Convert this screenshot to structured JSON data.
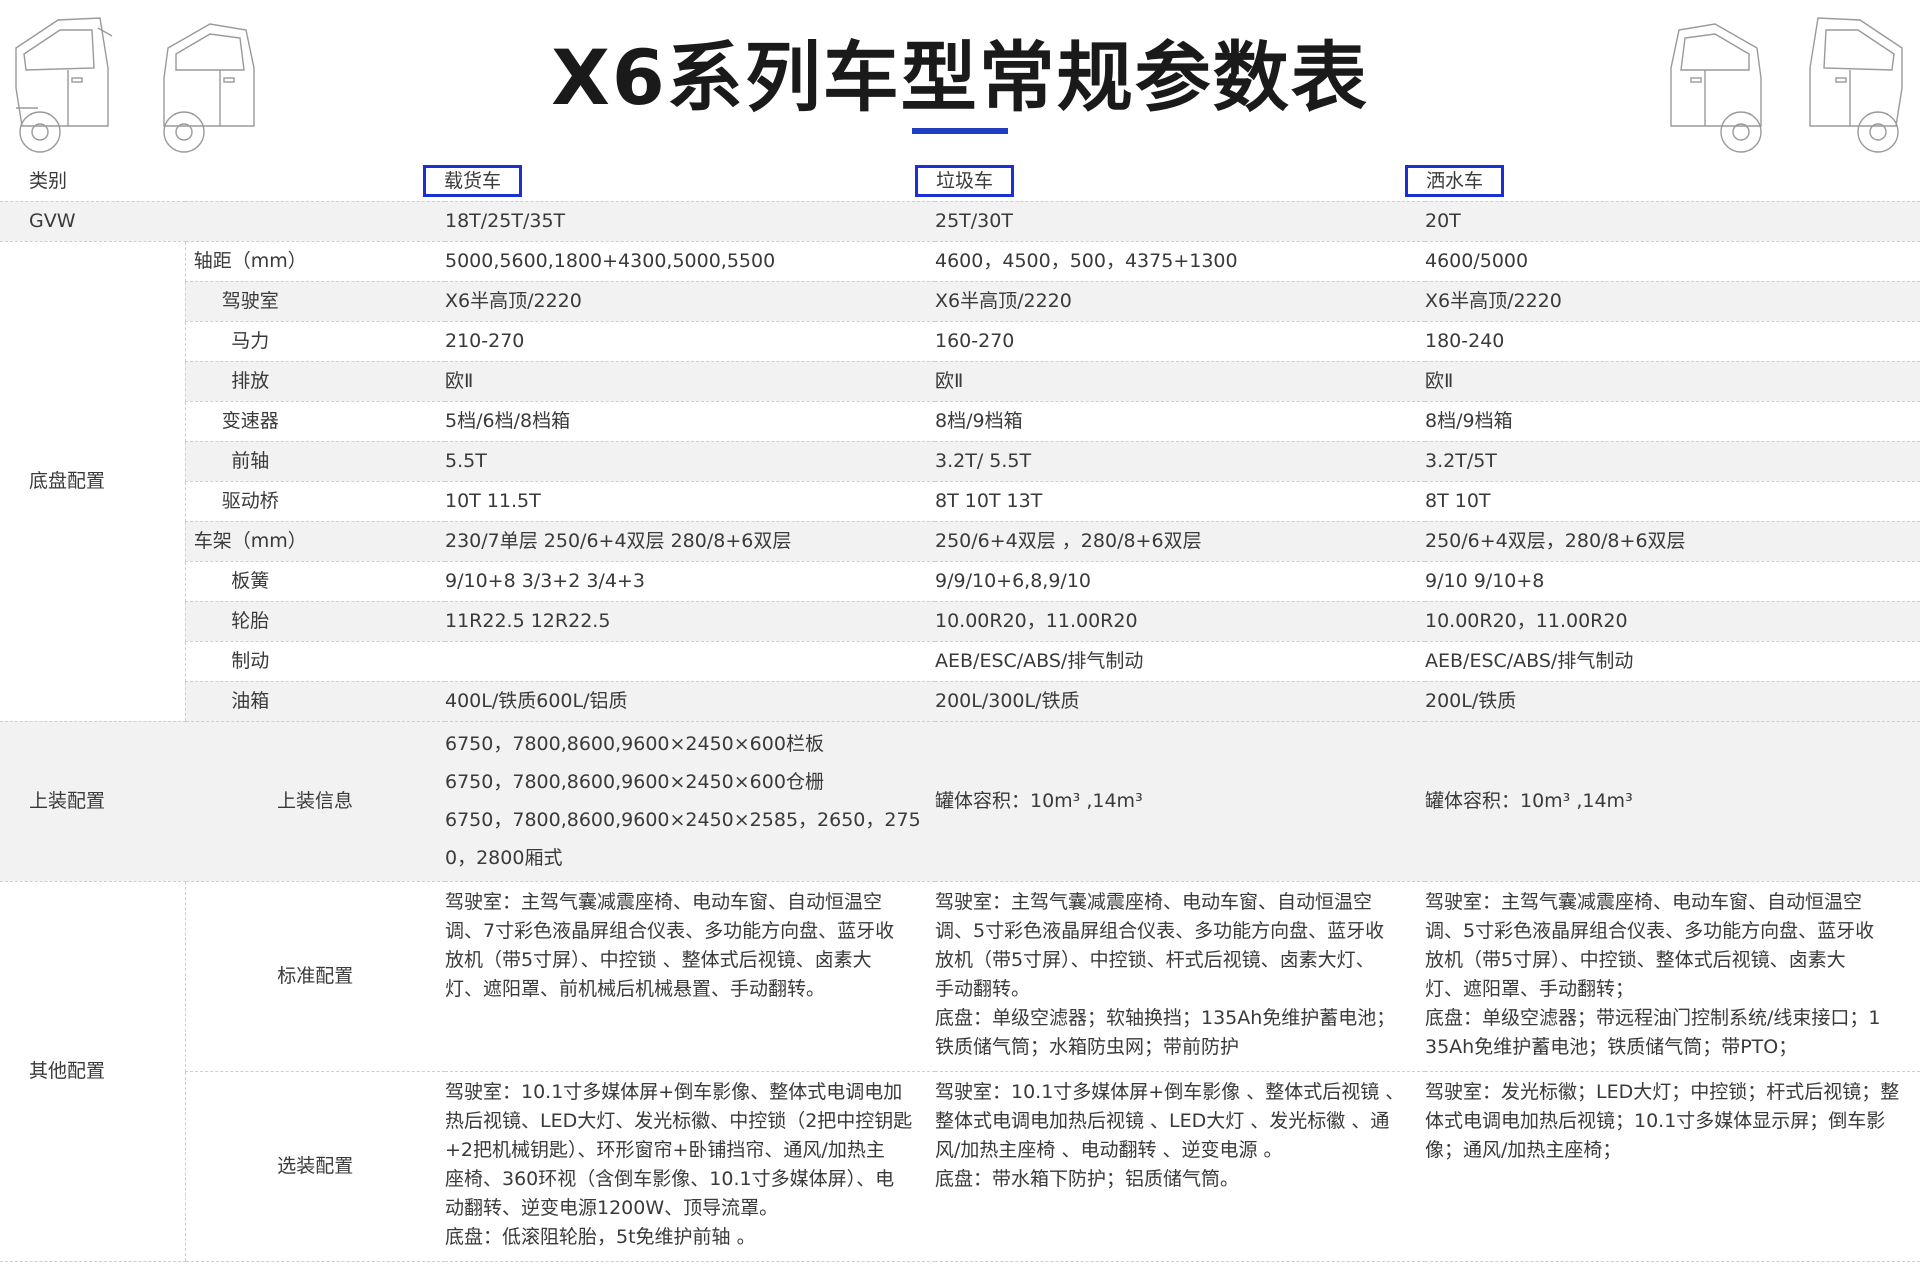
{
  "title": "X6系列车型常规参数表",
  "accent_color": "#1f3fbf",
  "box_color": "#1a2fd6",
  "header_row": {
    "label": "类别",
    "columns": [
      "载货车",
      "垃圾车",
      "洒水车"
    ]
  },
  "gvw_row": {
    "label": "GVW",
    "values": [
      "18T/25T/35T",
      "25T/30T",
      "20T"
    ]
  },
  "chassis": {
    "group_label": "底盘配置",
    "rows": [
      {
        "label": "轴距（mm）",
        "values": [
          "5000,5600,1800+4300,5000,5500",
          "4600，4500，500，4375+1300",
          "4600/5000"
        ]
      },
      {
        "label": "驾驶室",
        "values": [
          "X6半高顶/2220",
          "X6半高顶/2220",
          "X6半高顶/2220"
        ]
      },
      {
        "label": "马力",
        "values": [
          "210-270",
          "160-270",
          "180-240"
        ]
      },
      {
        "label": "排放",
        "values": [
          "欧Ⅱ",
          "欧Ⅱ",
          "欧Ⅱ"
        ]
      },
      {
        "label": "变速器",
        "values": [
          "5档/6档/8档箱",
          "8档/9档箱",
          "8档/9档箱"
        ]
      },
      {
        "label": "前轴",
        "values": [
          "5.5T",
          "3.2T/ 5.5T",
          "3.2T/5T"
        ]
      },
      {
        "label": "驱动桥",
        "values": [
          "10T 11.5T",
          "8T 10T 13T",
          "8T 10T"
        ]
      },
      {
        "label": "车架（mm）",
        "values": [
          "230/7单层 250/6+4双层 280/8+6双层",
          "250/6+4双层 ，280/8+6双层",
          "250/6+4双层，280/8+6双层"
        ]
      },
      {
        "label": "板簧",
        "values": [
          "9/10+8 3/3+2 3/4+3",
          "9/9/10+6,8,9/10",
          "9/10 9/10+8"
        ]
      },
      {
        "label": "轮胎",
        "values": [
          "11R22.5 12R22.5",
          "10.00R20，11.00R20",
          "10.00R20，11.00R20"
        ]
      },
      {
        "label": "制动",
        "values": [
          "",
          "AEB/ESC/ABS/排气制动",
          "AEB/ESC/ABS/排气制动"
        ]
      },
      {
        "label": "油箱",
        "values": [
          "400L/铁质600L/铝质",
          "200L/300L/铁质",
          "200L/铁质"
        ]
      }
    ]
  },
  "mount": {
    "group_label": "上装配置",
    "label": "上装信息",
    "col1_lines": [
      "6750，7800,8600,9600×2450×600栏板",
      "6750，7800,8600,9600×2450×600仓栅",
      "6750，7800,8600,9600×2450×2585，2650，275",
      "0，2800厢式"
    ],
    "col2": "罐体容积：10m³ ,14m³",
    "col3": "罐体容积：10m³ ,14m³"
  },
  "other": {
    "group_label": "其他配置",
    "standard": {
      "label": "标准配置",
      "col1_lines": [
        "驾驶室：主驾气囊减震座椅、电动车窗、自动恒温空",
        "调、7寸彩色液晶屏组合仪表、多功能方向盘、蓝牙收",
        "放机（带5寸屏）、中控锁 、整体式后视镜、卤素大",
        "灯、遮阳罩、前机械后机械悬置、手动翻转。"
      ],
      "col2_lines": [
        "驾驶室：主驾气囊减震座椅、电动车窗、自动恒温空",
        "调、5寸彩色液晶屏组合仪表、多功能方向盘、蓝牙收",
        "放机（带5寸屏）、中控锁、杆式后视镜、卤素大灯、",
        "手动翻转。",
        "底盘：单级空滤器；软轴换挡；135Ah免维护蓄电池；",
        "铁质储气筒；水箱防虫网；带前防护"
      ],
      "col3_lines": [
        "驾驶室：主驾气囊减震座椅、电动车窗、自动恒温空",
        "调、5寸彩色液晶屏组合仪表、多功能方向盘、蓝牙收",
        "放机（带5寸屏）、中控锁、整体式后视镜、卤素大",
        "灯、遮阳罩、手动翻转；",
        "底盘：单级空滤器；带远程油门控制系统/线束接口；1",
        "35Ah免维护蓄电池；铁质储气筒；带PTO；"
      ]
    },
    "optional": {
      "label": "选装配置",
      "col1_lines": [
        "驾驶室：10.1寸多媒体屏+倒车影像、整体式电调电加",
        "热后视镜、LED大灯、发光标徽、中控锁（2把中控钥匙",
        "+2把机械钥匙）、环形窗帘+卧铺挡帘、通风/加热主",
        "座椅、360环视（含倒车影像、10.1寸多媒体屏）、电",
        "动翻转、逆变电源1200W、顶导流罩。",
        "底盘：低滚阻轮胎，5t免维护前轴 。"
      ],
      "col2_lines": [
        "驾驶室：10.1寸多媒体屏+倒车影像 、整体式后视镜 、",
        "整体式电调电加热后视镜 、LED大灯 、发光标徽 、通",
        "风/加热主座椅 、电动翻转 、逆变电源 。",
        "底盘：带水箱下防护；铝质储气筒。"
      ],
      "col3_lines": [
        "驾驶室：发光标徽；LED大灯；中控锁；杆式后视镜；整",
        "体式电调电加热后视镜；10.1寸多媒体显示屏；倒车影",
        "像；通风/加热主座椅；"
      ]
    }
  }
}
